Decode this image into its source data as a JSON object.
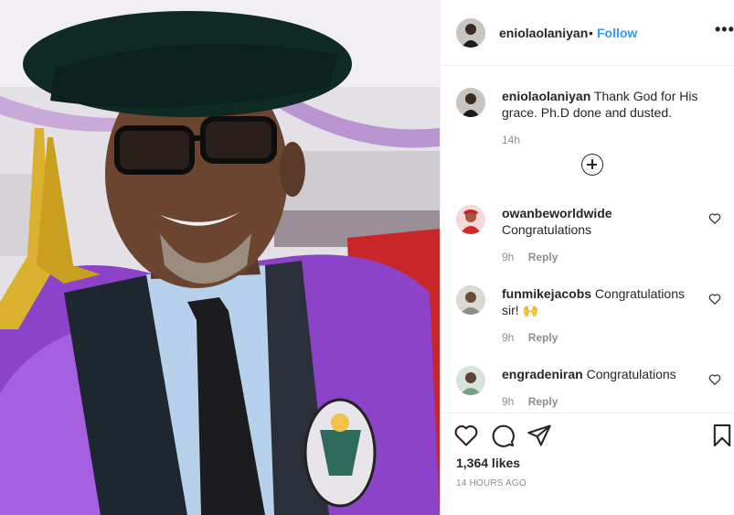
{
  "post": {
    "username": "eniolaolaniyan",
    "dot": "•",
    "follow_label": "Follow",
    "more_label": "•••",
    "caption_user": "eniolaolaniyan",
    "caption_text": "Thank God for His grace. Ph.D done and dusted.",
    "caption_time": "14h",
    "likes": "1,364 likes",
    "posted_ago": "14 HOURS AGO"
  },
  "comments": [
    {
      "user": "owanbeworldwide",
      "text": "Congratulations",
      "time": "9h",
      "reply_label": "Reply"
    },
    {
      "user": "funmikejacobs",
      "text": "Congratulations sir! 🙌",
      "time": "9h",
      "reply_label": "Reply"
    },
    {
      "user": "engradeniran",
      "text": "Congratulations",
      "time": "9h",
      "reply_label": "Reply"
    }
  ],
  "icons": {
    "like": "heart-icon",
    "comment": "comment-bubble-icon",
    "share": "paper-plane-icon",
    "save": "bookmark-icon",
    "load_more": "plus-circle-icon",
    "options": "more-options-icon"
  },
  "colors": {
    "link": "#3897f0",
    "muted": "#8e8e8e",
    "text": "#262626",
    "gown": "#8b3fc4"
  }
}
